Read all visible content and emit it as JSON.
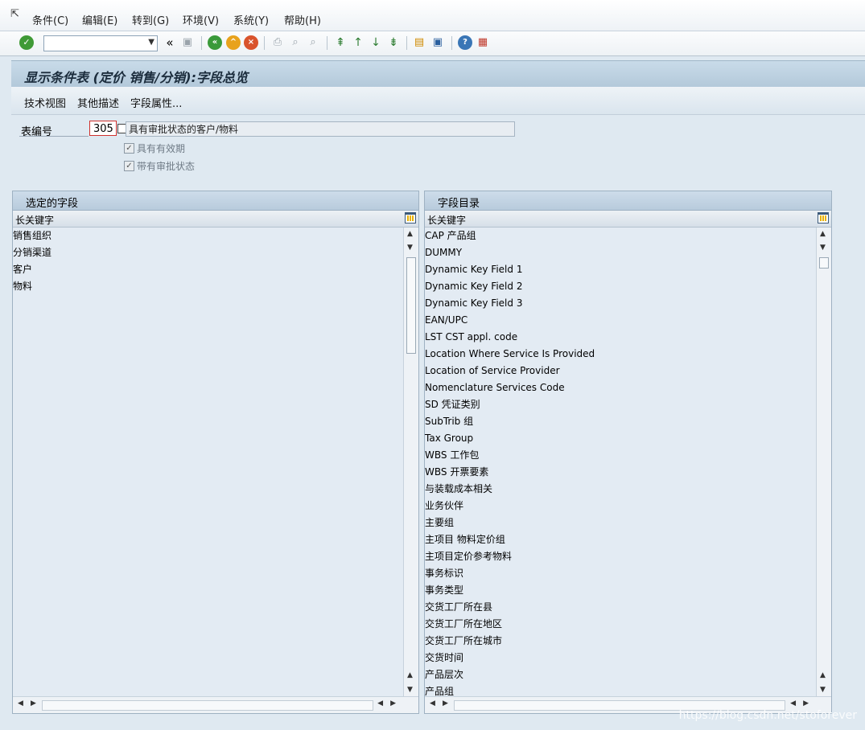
{
  "menu": [
    {
      "label": "条件(C)"
    },
    {
      "label": "编辑(E)"
    },
    {
      "label": "转到(G)"
    },
    {
      "label": "环境(V)"
    },
    {
      "label": "系统(Y)"
    },
    {
      "label": "帮助(H)"
    }
  ],
  "toolbar": {
    "command_value": "",
    "icons": [
      "enter-icon",
      "command-field",
      "collapse-icon",
      "save-icon",
      "back-icon",
      "exit-icon",
      "cancel-icon",
      "print-icon",
      "find-icon",
      "find-next-icon",
      "first-page-icon",
      "previous-page-icon",
      "next-page-icon",
      "last-page-icon",
      "new-session-icon",
      "shortcut-icon",
      "help-icon",
      "customize-layout-icon"
    ]
  },
  "title": "显示条件表 (定价 销售/分销):字段总览",
  "app_toolbar": {
    "tech_view": "技术视图",
    "other_desc": "其他描述",
    "field_attr": "字段属性..."
  },
  "header": {
    "table_label": "表编号",
    "table_value": "305",
    "description": "具有审批状态的客户/物料",
    "check1": "具有有效期",
    "check2": "带有审批状态",
    "check1_checked": true,
    "check2_checked": true
  },
  "left_panel": {
    "title": "选定的字段",
    "column": "长关键字",
    "rows": [
      "销售组织",
      "分销渠道",
      "客户",
      "物料"
    ]
  },
  "right_panel": {
    "title": "字段目录",
    "column": "长关键字",
    "rows": [
      "CAP 产品组",
      "DUMMY",
      "Dynamic Key Field 1",
      "Dynamic Key Field 2",
      "Dynamic Key Field 3",
      "EAN/UPC",
      "LST CST appl. code",
      "Location Where Service Is Provided",
      "Location of Service Provider",
      "Nomenclature Services Code",
      "SD 凭证类别",
      "SubTrib 组",
      "Tax Group",
      "WBS 工作包",
      "WBS 开票要素",
      "与装载成本相关",
      "业务伙伴",
      "主要组",
      "主项目 物料定价组",
      "主项目定价参考物料",
      "事务标识",
      "事务类型",
      "交货工厂所在县",
      "交货工厂所在地区",
      "交货工厂所在城市",
      "交货时间",
      "产品层次",
      "产品组"
    ]
  },
  "watermark": "https://blog.csdn.net/stoforever"
}
